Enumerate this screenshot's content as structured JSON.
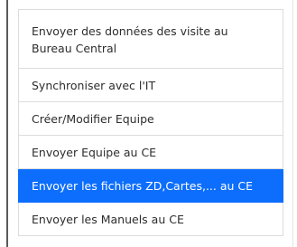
{
  "menu": {
    "items": [
      {
        "label": "Envoyer des données des visite au Bureau Central"
      },
      {
        "label": "Synchroniser avec l'IT"
      },
      {
        "label": "Créer/Modifier Equipe"
      },
      {
        "label": "Envoyer Equipe au CE"
      },
      {
        "label": "Envoyer les fichiers ZD,Cartes,... au CE"
      },
      {
        "label": "Envoyer les Manuels au CE"
      }
    ],
    "active_index": 4,
    "active_color": "#0d6efd"
  }
}
